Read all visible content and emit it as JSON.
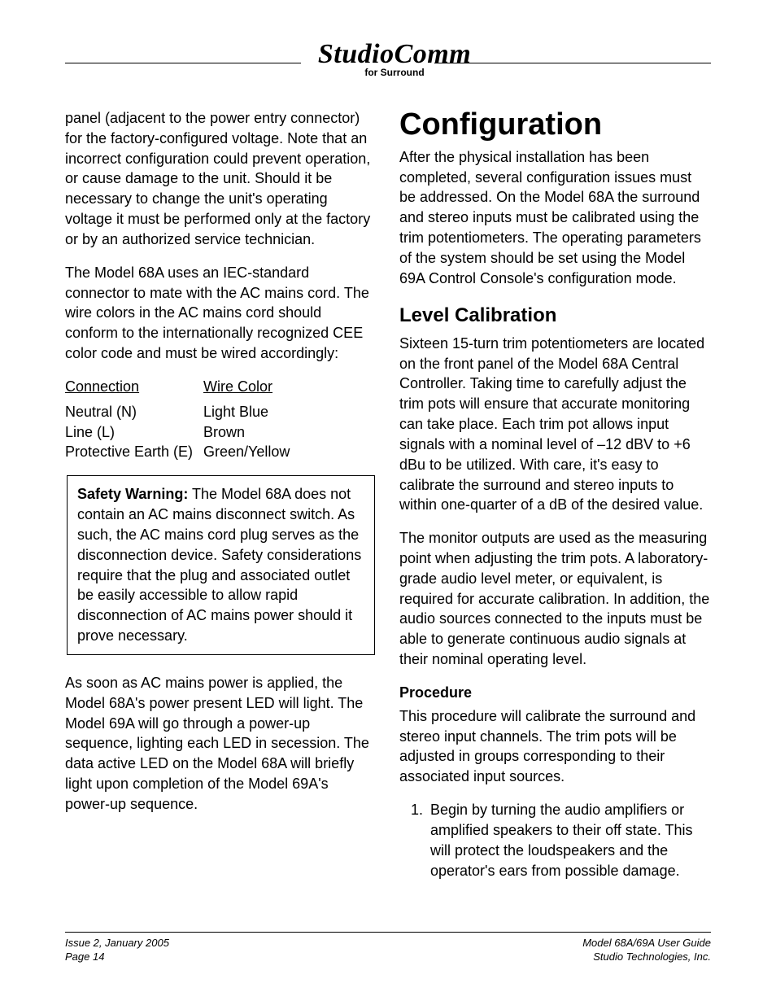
{
  "header": {
    "brand_main": "StudioComm",
    "brand_sub": "for Surround"
  },
  "left": {
    "p1": "panel (adjacent to the power entry connector) for the factory-configured voltage. Note that an incorrect configuration could prevent operation, or cause damage to the unit. Should it be necessary to change the unit's operating voltage it must be performed only at the factory or by an authorized service technician.",
    "p2": "The Model 68A uses an IEC-standard connector to mate with the AC mains cord. The wire colors in the AC mains cord should conform to the internationally recognized CEE color code and must be wired accordingly:",
    "table": {
      "head_connection": "Connection",
      "head_wire_color": "Wire Color",
      "rows": [
        {
          "connection": "Neutral (N)",
          "color": "Light Blue"
        },
        {
          "connection": "Line (L)",
          "color": "Brown"
        },
        {
          "connection": "Protective Earth (E)",
          "color": "Green/Yellow"
        }
      ]
    },
    "warning_label": "Safety Warning:",
    "warning_body": " The Model 68A does not contain an AC mains disconnect switch. As such, the AC mains cord plug serves as the disconnection device. Safety considerations require that the plug and associated outlet be easily accessible to allow rapid disconnection of AC mains power should it prove necessary.",
    "p3": "As soon as AC mains power is applied, the Model 68A's power present LED will light. The Model 69A will go through a power-up sequence, lighting each LED in secession. The data active LED on the Model 68A will briefly light upon completion of the Model 69A's power-up sequence."
  },
  "right": {
    "h1": "Configuration",
    "intro": "After the physical installation has been completed, several configuration issues must be addressed. On the Model 68A the surround and stereo inputs must be calibrated using the trim potentiometers. The operating parameters of the system should be set using the Model 69A Control Console's configuration mode.",
    "h2": "Level Calibration",
    "lc_p1": "Sixteen 15-turn trim potentiometers are located on the front panel of the Model 68A Central Controller. Taking time to carefully adjust the trim pots will ensure that accurate monitoring can take place. Each trim pot allows input signals with a nominal level of –12 dBV to +6 dBu to be utilized. With care, it's easy to calibrate the surround and stereo inputs to within one-quarter of a dB of the desired value.",
    "lc_p2": "The monitor outputs are used as the measuring point when adjusting the trim pots. A laboratory-grade audio level meter, or equivalent, is required for accurate calibration. In addition, the audio sources connected to the inputs must be able to generate continuous audio signals at their nominal operating level.",
    "proc_head": "Procedure",
    "proc_intro": "This procedure will calibrate the surround and stereo input channels. The trim pots will be adjusted in groups corresponding to their associated input sources.",
    "step1": "Begin by turning the audio amplifiers or amplified speakers to their off state. This will protect the loudspeakers and the operator's ears from possible damage."
  },
  "footer": {
    "left_line1": "Issue 2, January 2005",
    "left_line2": "Page 14",
    "right_line1": "Model 68A/69A User Guide",
    "right_line2": "Studio Technologies, Inc."
  }
}
